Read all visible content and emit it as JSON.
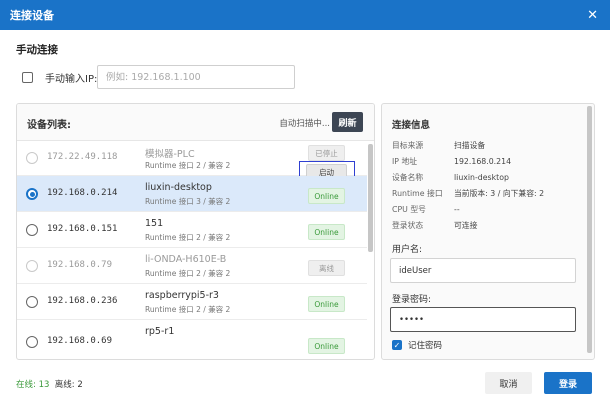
{
  "dialog": {
    "title": "连接设备",
    "close_icon": "close-icon"
  },
  "manual": {
    "section_title": "手动连接",
    "checkbox_label": "手动输入IP:",
    "ip_placeholder": "例如: 192.168.1.100",
    "checked": false
  },
  "device_list": {
    "title": "设备列表:",
    "scan_status": "自动扫描中...",
    "refresh_label": "刷新",
    "rows": [
      {
        "ip": "172.22.49.118",
        "name": "模拟器-PLC",
        "sub": "Runtime 接口 2 / 兼容 2",
        "status": "已停止",
        "action": "启动"
      },
      {
        "ip": "192.168.0.214",
        "name": "liuxin-desktop",
        "sub": "Runtime 接口 3 / 兼容 2",
        "status": "Online"
      },
      {
        "ip": "192.168.0.151",
        "name": "151",
        "sub": "Runtime 接口 2 / 兼容 2",
        "status": "Online"
      },
      {
        "ip": "192.168.0.79",
        "name": "li-ONDA-H610E-B",
        "sub": "Runtime 接口 2 / 兼容 2",
        "status": "离线"
      },
      {
        "ip": "192.168.0.236",
        "name": "raspberrypi5-r3",
        "sub": "Runtime 接口 2 / 兼容 2",
        "status": "Online"
      },
      {
        "ip": "192.168.0.69",
        "name": "rp5-r1",
        "sub": "",
        "status": "Online"
      }
    ]
  },
  "info": {
    "title": "连接信息",
    "fields": [
      {
        "k": "目标来源",
        "v": "扫描设备"
      },
      {
        "k": "IP 地址",
        "v": "192.168.0.214"
      },
      {
        "k": "设备名称",
        "v": "liuxin-desktop"
      },
      {
        "k": "Runtime 接口",
        "v": "当前版本: 3 / 向下兼容: 2"
      },
      {
        "k": "CPU 型号",
        "v": "--"
      },
      {
        "k": "登录状态",
        "v": "可连接"
      }
    ],
    "username_label": "用户名:",
    "username_value": "ideUser",
    "password_label": "登录密码:",
    "password_value": "•••••",
    "remember_label": "记住密码",
    "remember_checked": true
  },
  "footer": {
    "online_text": "在线: 13",
    "offline_text": "离线: 2",
    "cancel_label": "取消",
    "login_label": "登录"
  },
  "colors": {
    "accent": "#1a73c8",
    "online": "#3b9a3b",
    "refresh_bg": "#3d4654"
  }
}
